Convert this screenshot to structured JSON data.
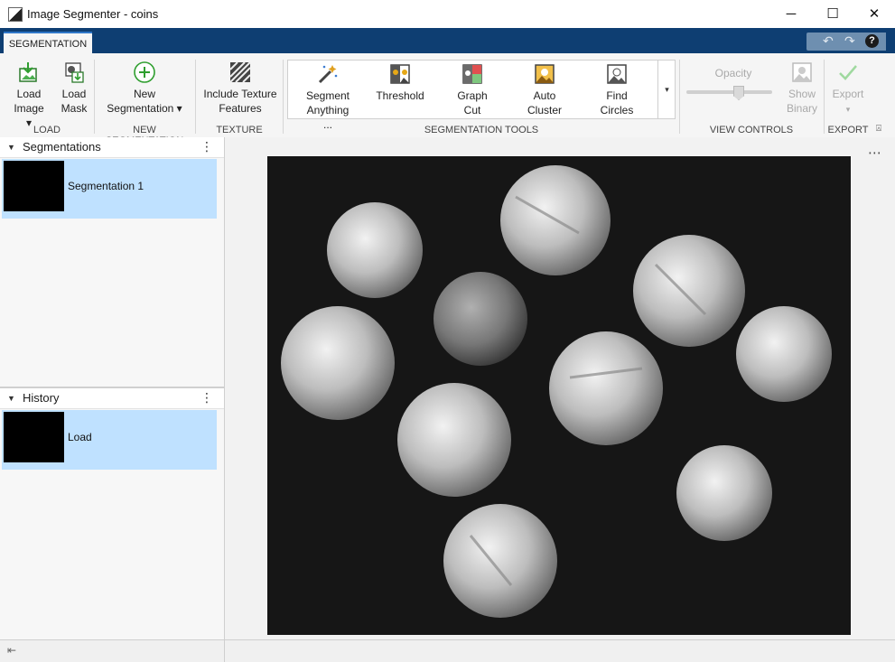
{
  "window": {
    "title": "Image Segmenter - coins",
    "minimize": "─",
    "maximize": "☐",
    "close": "✕"
  },
  "tabs": [
    {
      "label": "SEGMENTATION"
    }
  ],
  "quick_access": {
    "undo": "↶",
    "redo": "↷",
    "help": "?"
  },
  "ribbon": {
    "load": {
      "group": "LOAD",
      "load_image": [
        "Load",
        "Image ▾"
      ],
      "load_mask": [
        "Load",
        "Mask"
      ]
    },
    "new_segmentation": {
      "group": "NEW SEGMENTATION",
      "button": [
        "New",
        "Segmentation ▾"
      ]
    },
    "texture": {
      "group": "TEXTURE",
      "button": [
        "Include Texture",
        "Features"
      ]
    },
    "segmentation_tools": {
      "group": "SEGMENTATION TOOLS",
      "tools": [
        {
          "l1": "Segment",
          "l2": "Anything ..."
        },
        {
          "l1": "Threshold",
          "l2": ""
        },
        {
          "l1": "Graph",
          "l2": "Cut"
        },
        {
          "l1": "Auto",
          "l2": "Cluster"
        },
        {
          "l1": "Find",
          "l2": "Circles"
        }
      ],
      "more": "▾"
    },
    "view_controls": {
      "group": "VIEW CONTROLS",
      "opacity": "Opacity",
      "show_binary": [
        "Show",
        "Binary"
      ]
    },
    "export": {
      "group": "EXPORT",
      "button": [
        "Export",
        "▾"
      ]
    }
  },
  "segmentations_panel": {
    "title": "Segmentations",
    "items": [
      {
        "label": "Segmentation 1"
      }
    ]
  },
  "history_panel": {
    "title": "History",
    "items": [
      {
        "label": "Load"
      }
    ]
  },
  "colors": {
    "titlebar_bg": "#ffffff",
    "tabbar_bg": "#0e3e72",
    "selection": "#bfe1ff",
    "image_bg": "#111111"
  },
  "icons": [
    "load-image-icon",
    "load-mask-icon",
    "add-circle-icon",
    "texture-icon",
    "magic-wand-icon",
    "threshold-icon",
    "graph-cut-icon",
    "auto-cluster-icon",
    "find-circles-icon",
    "show-binary-icon",
    "export-check-icon",
    "collapse-ribbon-icon",
    "more-options-icon"
  ]
}
